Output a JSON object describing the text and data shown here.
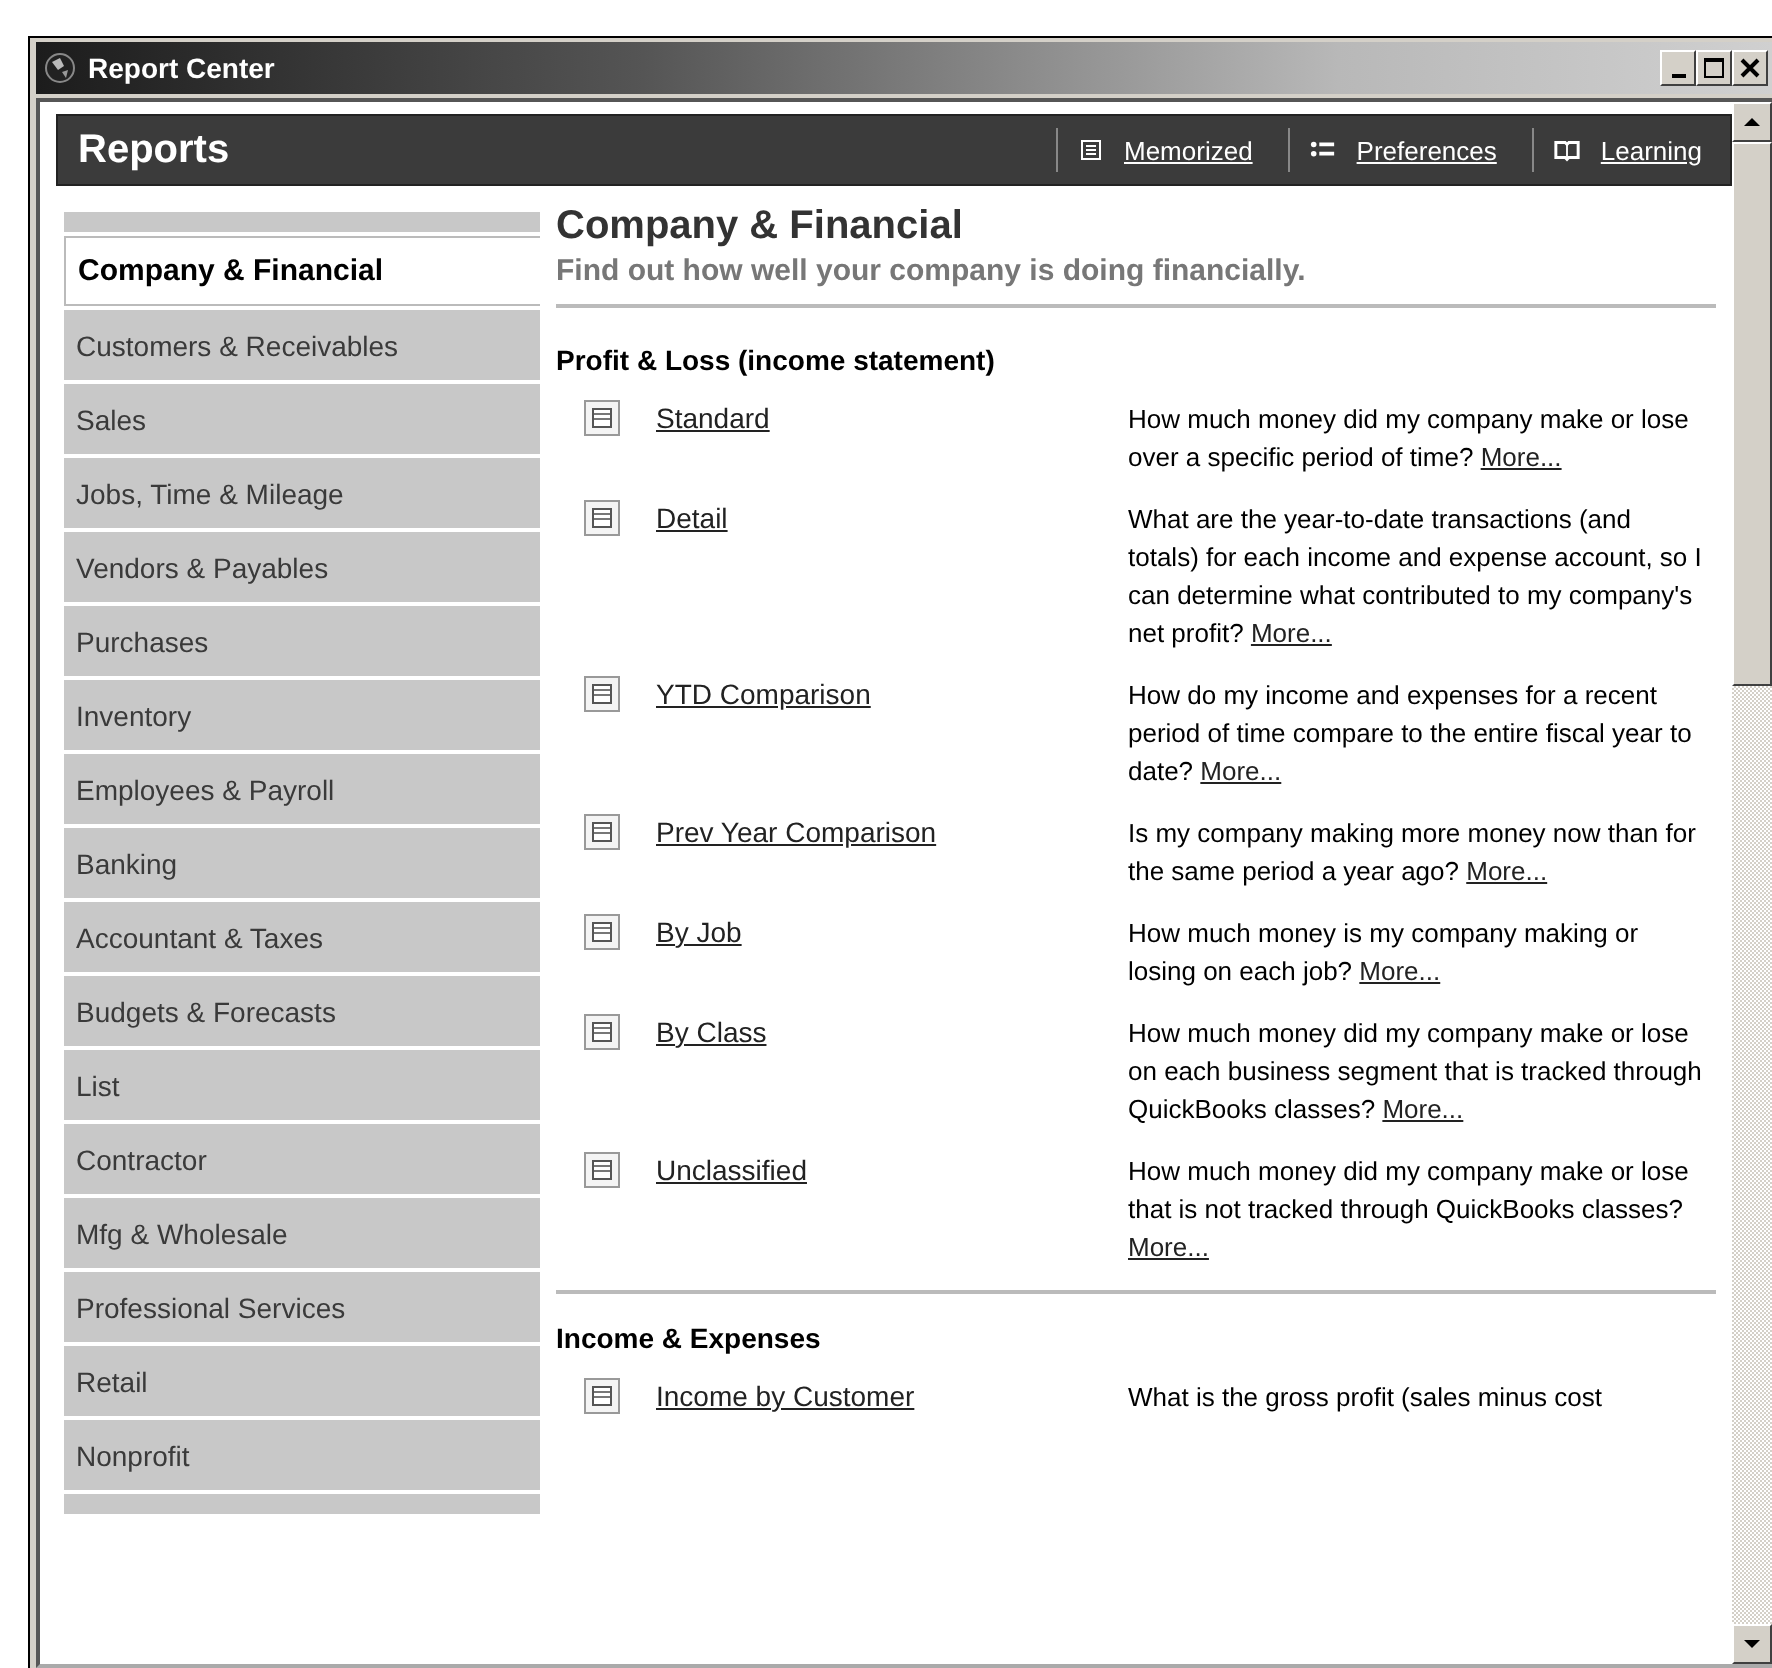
{
  "window": {
    "title": "Report Center"
  },
  "header": {
    "title": "Reports",
    "links": [
      {
        "label": "Memorized"
      },
      {
        "label": "Preferences"
      },
      {
        "label": "Learning"
      }
    ]
  },
  "sidebar": {
    "items": [
      {
        "label": "Company & Financial",
        "selected": true
      },
      {
        "label": "Customers & Receivables",
        "selected": false
      },
      {
        "label": "Sales",
        "selected": false
      },
      {
        "label": "Jobs, Time & Mileage",
        "selected": false
      },
      {
        "label": "Vendors & Payables",
        "selected": false
      },
      {
        "label": "Purchases",
        "selected": false
      },
      {
        "label": "Inventory",
        "selected": false
      },
      {
        "label": "Employees & Payroll",
        "selected": false
      },
      {
        "label": "Banking",
        "selected": false
      },
      {
        "label": "Accountant & Taxes",
        "selected": false
      },
      {
        "label": "Budgets & Forecasts",
        "selected": false
      },
      {
        "label": "List",
        "selected": false
      },
      {
        "label": "Contractor",
        "selected": false
      },
      {
        "label": "Mfg & Wholesale",
        "selected": false
      },
      {
        "label": "Professional Services",
        "selected": false
      },
      {
        "label": "Retail",
        "selected": false
      },
      {
        "label": "Nonprofit",
        "selected": false
      }
    ]
  },
  "content": {
    "title": "Company & Financial",
    "subtitle": "Find out how well your company is doing financially.",
    "sections": [
      {
        "heading": "Profit & Loss (income statement)",
        "reports": [
          {
            "name": "Standard",
            "description": "How much money did my company make or lose over a specific period of time?",
            "more": "More..."
          },
          {
            "name": "Detail",
            "description": "What are the year-to-date transactions (and totals) for each income and expense account, so I can determine what contributed to my company's net profit?",
            "more": "More..."
          },
          {
            "name": "YTD Comparison",
            "description": "How do my income and expenses for a recent period of time compare to the entire fiscal year to date?",
            "more": "More..."
          },
          {
            "name": "Prev Year Comparison",
            "description": "Is my company making more money now than for the same period a year ago?",
            "more": "More..."
          },
          {
            "name": "By Job",
            "description": "How much money is my company making or losing on each job?",
            "more": "More..."
          },
          {
            "name": "By Class",
            "description": "How much money did my company make or lose on each business segment that is tracked through QuickBooks classes?",
            "more": "More..."
          },
          {
            "name": "Unclassified",
            "description": "How much money did my company make or lose that is not tracked through QuickBooks classes?",
            "more": "More..."
          }
        ]
      },
      {
        "heading": "Income & Expenses",
        "reports": [
          {
            "name": "Income by Customer",
            "description": "What is the gross profit (sales minus cost"
          }
        ]
      }
    ]
  }
}
